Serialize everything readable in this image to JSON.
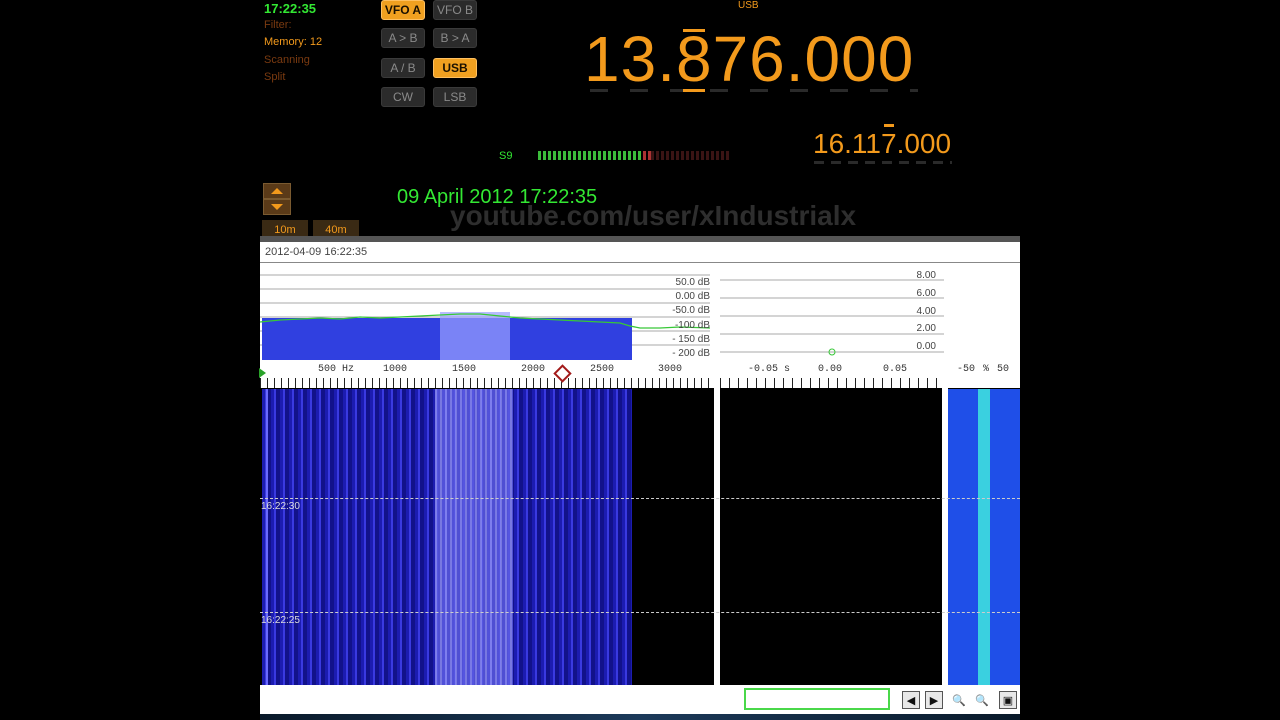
{
  "status": {
    "clock": "17:22:35",
    "filter_label": "Filter:",
    "memory_label": "Memory: 12",
    "scanning_label": "Scanning",
    "split_label": "Split"
  },
  "buttons": {
    "vfo_a": "VFO A",
    "vfo_b": "VFO B",
    "a_to_b": "A > B",
    "b_to_a": "B > A",
    "a_slash_b": "A / B",
    "usb": "USB",
    "cw": "CW",
    "lsb": "LSB"
  },
  "display": {
    "mode": "USB",
    "main_frequency": "13.876.000",
    "sub_frequency": "16.117.000",
    "s_meter_label": "S9",
    "datetime": "09 April 2012 17:22:35",
    "watermark": "youtube.com/user/xIndustrialx"
  },
  "bands": {
    "band_10m": "10m",
    "band_40m": "40m"
  },
  "spectrum": {
    "timestamp": "2012-04-09 16:22:35",
    "db_scale": [
      "50.0 dB",
      "0.00 dB",
      "-50.0 dB",
      "-100 dB",
      "- 150 dB",
      "- 200 dB"
    ],
    "freq_scale": [
      "500 Hz",
      "1000",
      "1500",
      "2000",
      "2500",
      "3000"
    ],
    "time_scale": [
      "-0.05 s",
      "0.00",
      "0.05"
    ],
    "right_scale": [
      "8.00",
      "6.00",
      "4.00",
      "2.00",
      "0.00"
    ],
    "pct_scale": [
      "-50",
      "%",
      "50"
    ],
    "time_marks": [
      "16:22:30",
      "16:22:25"
    ]
  },
  "colors": {
    "accent_orange": "#f39a1c",
    "clock_green": "#33e833",
    "waterfall_blue": "#2a2ad8"
  }
}
